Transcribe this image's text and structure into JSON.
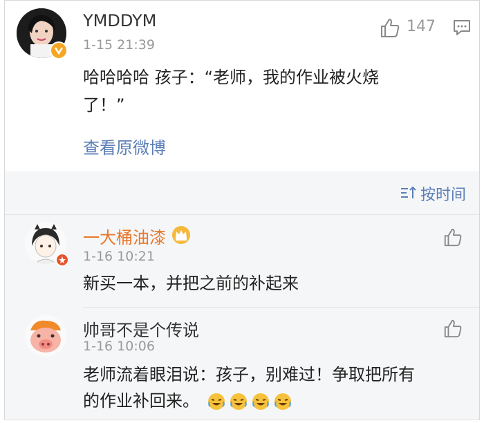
{
  "post": {
    "author": "YMDDYM",
    "time": "1-15 21:39",
    "like_count": "147",
    "text_line1": "哈哈哈哈 孩子：“老师，我的作业被火烧",
    "text_line2": "了！”",
    "view_original": "查看原微博"
  },
  "sort": {
    "label": "按时间"
  },
  "comments": [
    {
      "author": "一大桶油漆",
      "time": "1-16 10:21",
      "text": "新买一本，并把之前的补起来"
    },
    {
      "author": "帅哥不是个传说",
      "time": "1-16 10:06",
      "text_line1": "老师流着眼泪说：孩子，别难过！争取把所有",
      "text_line2": "的作业补回来。"
    }
  ],
  "colors": {
    "link": "#5b7eb6",
    "orange_name": "#e8772a",
    "verified": "#f5a623"
  }
}
